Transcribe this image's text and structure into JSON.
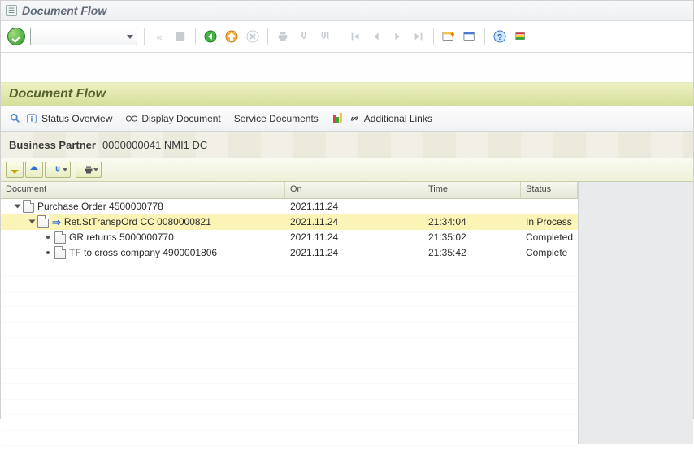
{
  "window": {
    "title": "Document Flow"
  },
  "subheader": {
    "title": "Document Flow"
  },
  "actions": {
    "status_overview": "Status Overview",
    "display_document": "Display Document",
    "service_documents": "Service Documents",
    "additional_links": "Additional Links"
  },
  "bp": {
    "label": "Business Partner",
    "value": "0000000041 NMI1 DC"
  },
  "columns": {
    "document": "Document",
    "on": "On",
    "time": "Time",
    "status": "Status"
  },
  "rows": [
    {
      "level": 1,
      "expand": "open",
      "icon": "doc",
      "text": "Purchase Order 4500000778",
      "on": "2021.11.24",
      "time": "",
      "status": ""
    },
    {
      "level": 2,
      "expand": "open",
      "icon": "doc-arrow",
      "text": "Ret.StTranspOrd CC 0080000821",
      "on": "2021.11.24",
      "time": "21:34:04",
      "status": "In Process",
      "selected": true
    },
    {
      "level": 3,
      "expand": "leaf",
      "icon": "doc",
      "text": "GR returns 5000000770",
      "on": "2021.11.24",
      "time": "21:35:02",
      "status": "Completed"
    },
    {
      "level": 3,
      "expand": "leaf",
      "icon": "doc",
      "text": "TF to cross company 4900001806",
      "on": "2021.11.24",
      "time": "21:35:42",
      "status": "Complete"
    }
  ],
  "icons": {
    "back_all": "«",
    "help": "?",
    "layout": "⊞"
  }
}
